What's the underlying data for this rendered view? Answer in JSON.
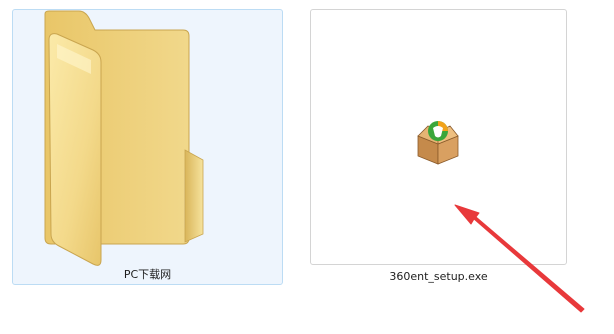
{
  "items": [
    {
      "name": "PC下载网",
      "type": "folder",
      "selected": true,
      "icon": "folder-icon"
    },
    {
      "name": "360ent_setup.exe",
      "type": "executable",
      "selected": false,
      "icon": "installer-package-icon"
    }
  ],
  "annotation": {
    "shape": "arrow",
    "color": "#e8393b",
    "points_to": "360ent_setup.exe"
  },
  "colors": {
    "selection_fill": "#eef5fd",
    "selection_border": "#bcdcf4",
    "folder_yellow": "#f3dc8c",
    "item_border": "#d4d4d4"
  }
}
